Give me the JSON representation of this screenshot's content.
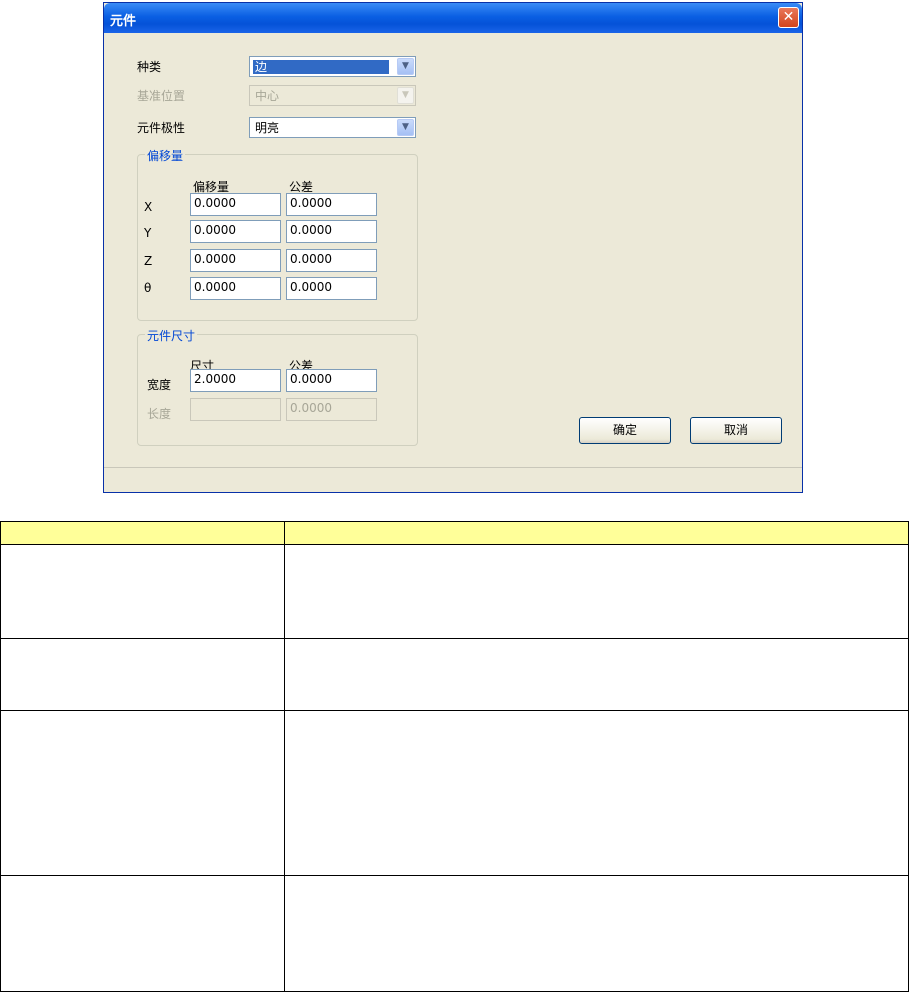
{
  "dialog": {
    "title": "元件",
    "close_symbol": "✕",
    "fields": {
      "type_label": "种类",
      "type_value": "边",
      "reference_label": "基准位置",
      "reference_value": "中心",
      "polarity_label": "元件极性",
      "polarity_value": "明亮"
    },
    "offset_group": {
      "title": "偏移量",
      "col_offset": "偏移量",
      "col_tolerance": "公差",
      "rows": [
        {
          "axis": "X",
          "offset": "0.0000",
          "tolerance": "0.0000"
        },
        {
          "axis": "Y",
          "offset": "0.0000",
          "tolerance": "0.0000"
        },
        {
          "axis": "Z",
          "offset": "0.0000",
          "tolerance": "0.0000"
        },
        {
          "axis": "θ",
          "offset": "0.0000",
          "tolerance": "0.0000"
        }
      ]
    },
    "size_group": {
      "title": "元件尺寸",
      "col_size": "尺寸",
      "col_tolerance": "公差",
      "width_label": "宽度",
      "width_value": "2.0000",
      "width_tolerance": "0.0000",
      "length_label": "长度",
      "length_value": "",
      "length_tolerance": "0.0000"
    },
    "buttons": {
      "ok": "确定",
      "cancel": "取消"
    },
    "dropdown_arrow": "▼"
  },
  "colors": {
    "title_bar": "#0a5fe3",
    "dialog_bg": "#ece9d8",
    "group_title": "#0046d5",
    "table_header": "#ffff99"
  }
}
